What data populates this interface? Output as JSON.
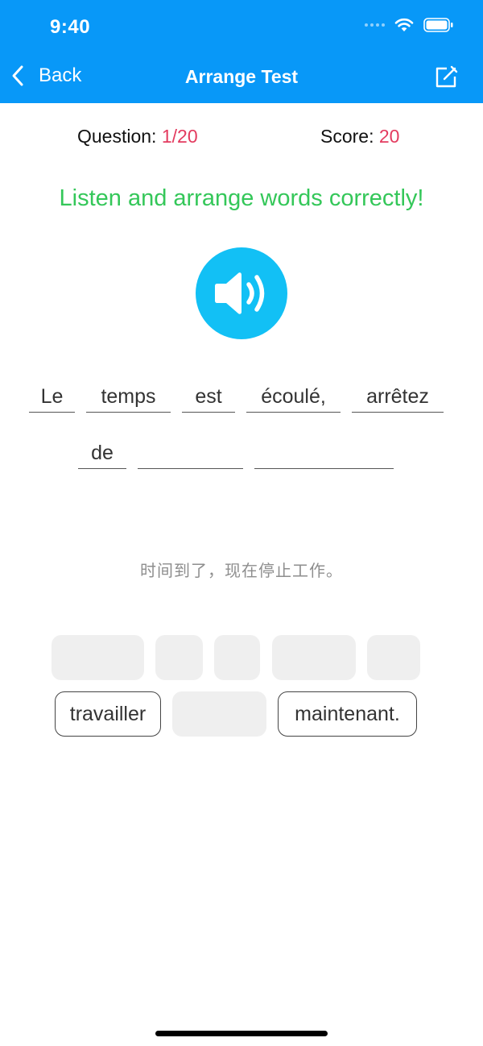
{
  "status_bar": {
    "time": "9:40"
  },
  "nav": {
    "back_label": "Back",
    "title": "Arrange Test"
  },
  "stats": {
    "question_label": "Question: ",
    "question_value": "1/20",
    "score_label": "Score: ",
    "score_value": "20"
  },
  "instruction": "Listen and arrange words correctly!",
  "answer_slots": [
    "Le",
    "temps",
    "est",
    "écoulé,",
    "arrêtez",
    "de",
    "",
    ""
  ],
  "translation": "时间到了，现在停止工作。",
  "word_bank": [
    "",
    "",
    "",
    "",
    "",
    "travailler",
    "",
    "maintenant."
  ],
  "colors": {
    "nav_bar": "#0898f8",
    "accent_red": "#e33b5f",
    "instruction_green": "#34c759",
    "speaker_blue": "#12c0f5"
  }
}
